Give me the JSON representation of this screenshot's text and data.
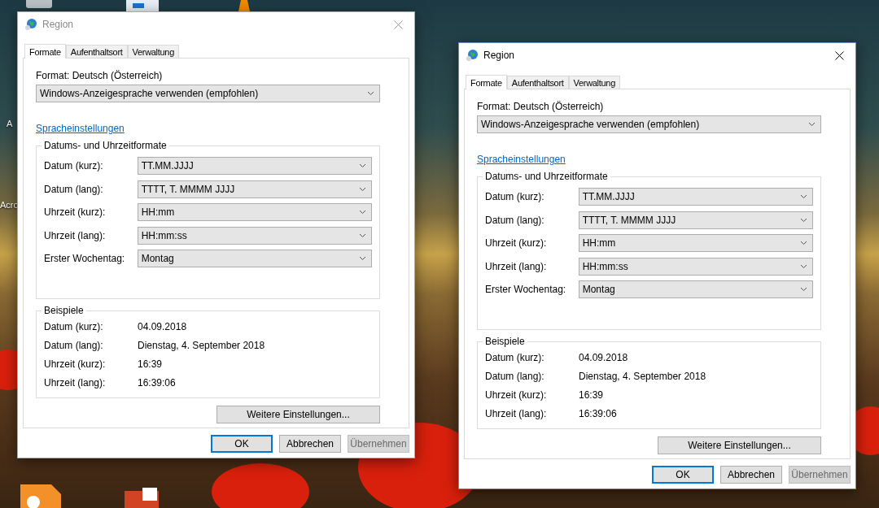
{
  "desktop": {
    "icon_labels": [
      "A",
      "Acro"
    ],
    "windows": [
      {
        "title": "Region",
        "active": false,
        "tabs": [
          {
            "label": "Formate",
            "selected": true
          },
          {
            "label": "Aufenthaltsort",
            "selected": false
          },
          {
            "label": "Verwaltung",
            "selected": false
          }
        ],
        "format_label": "Format: Deutsch (Österreich)",
        "format_value": "Windows-Anzeigesprache verwenden (empfohlen)",
        "link": "Spracheinstellungen",
        "formats_group": {
          "title": "Datums- und Uhrzeitformate",
          "rows": [
            {
              "label": "Datum (kurz):",
              "value": "TT.MM.JJJJ"
            },
            {
              "label": "Datum (lang):",
              "value": "TTTT, T. MMMM JJJJ"
            },
            {
              "label": "Uhrzeit (kurz):",
              "value": "HH:mm"
            },
            {
              "label": "Uhrzeit (lang):",
              "value": "HH:mm:ss"
            },
            {
              "label": "Erster Wochentag:",
              "value": "Montag"
            }
          ]
        },
        "examples_group": {
          "title": "Beispiele",
          "rows": [
            {
              "label": "Datum (kurz):",
              "value": "04.09.2018"
            },
            {
              "label": "Datum (lang):",
              "value": "Dienstag, 4. September 2018"
            },
            {
              "label": "Uhrzeit (kurz):",
              "value": "16:39"
            },
            {
              "label": "Uhrzeit (lang):",
              "value": "16:39:06"
            }
          ]
        },
        "more_button": "Weitere Einstellungen...",
        "buttons": [
          {
            "label": "OK",
            "default": true,
            "disabled": false
          },
          {
            "label": "Abbrechen",
            "default": false,
            "disabled": false
          },
          {
            "label": "Übernehmen",
            "default": false,
            "disabled": true
          }
        ]
      },
      {
        "title": "Region",
        "active": true,
        "tabs": [
          {
            "label": "Formate",
            "selected": true
          },
          {
            "label": "Aufenthaltsort",
            "selected": false
          },
          {
            "label": "Verwaltung",
            "selected": false
          }
        ],
        "format_label": "Format: Deutsch (Österreich)",
        "format_value": "Windows-Anzeigesprache verwenden (empfohlen)",
        "link": "Spracheinstellungen",
        "formats_group": {
          "title": "Datums- und Uhrzeitformate",
          "rows": [
            {
              "label": "Datum (kurz):",
              "value": "TT.MM.JJJJ"
            },
            {
              "label": "Datum (lang):",
              "value": "TTTT, T. MMMM JJJJ"
            },
            {
              "label": "Uhrzeit (kurz):",
              "value": "HH:mm"
            },
            {
              "label": "Uhrzeit (lang):",
              "value": "HH:mm:ss"
            },
            {
              "label": "Erster Wochentag:",
              "value": "Montag"
            }
          ]
        },
        "examples_group": {
          "title": "Beispiele",
          "rows": [
            {
              "label": "Datum (kurz):",
              "value": "04.09.2018"
            },
            {
              "label": "Datum (lang):",
              "value": "Dienstag, 4. September 2018"
            },
            {
              "label": "Uhrzeit (kurz):",
              "value": "16:39"
            },
            {
              "label": "Uhrzeit (lang):",
              "value": "16:39:06"
            }
          ]
        },
        "more_button": "Weitere Einstellungen...",
        "buttons": [
          {
            "label": "OK",
            "default": true,
            "disabled": false
          },
          {
            "label": "Abbrechen",
            "default": false,
            "disabled": false
          },
          {
            "label": "Übernehmen",
            "default": false,
            "disabled": true
          }
        ]
      }
    ]
  }
}
